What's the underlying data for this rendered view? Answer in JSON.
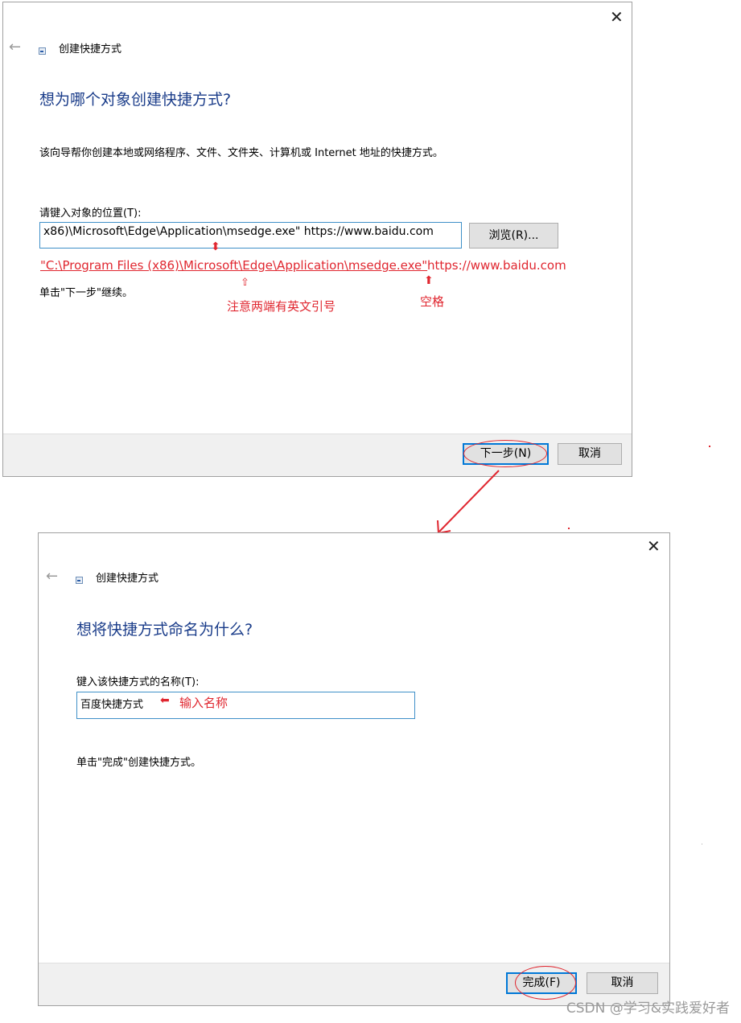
{
  "dialog1": {
    "close_glyph": "✕",
    "back_glyph": "←",
    "window_title": "创建快捷方式",
    "heading": "想为哪个对象创建快捷方式?",
    "description": "该向导帮你创建本地或网络程序、文件、文件夹、计算机或 Internet 地址的快捷方式。",
    "location_label": "请键入对象的位置(T):",
    "location_value": "x86)\\Microsoft\\Edge\\Application\\msedge.exe\" https://www.baidu.com",
    "browse_button": "浏览(R)...",
    "continue_text": "单击\"下一步\"继续。",
    "next_button": "下一步(N)",
    "cancel_button": "取消"
  },
  "annotations": {
    "full_path": "\"C:\\Program Files (x86)\\Microsoft\\Edge\\Application\\msedge.exe\"",
    "url_part": " https://www.baidu.com",
    "quotes_note": "注意两端有英文引号",
    "space_note": "空格",
    "name_note": "输入名称",
    "accent_color": "#e0262f"
  },
  "dialog2": {
    "close_glyph": "✕",
    "back_glyph": "←",
    "window_title": "创建快捷方式",
    "heading": "想将快捷方式命名为什么?",
    "name_label": "键入该快捷方式的名称(T):",
    "name_value": "百度快捷方式",
    "finish_text": "单击\"完成\"创建快捷方式。",
    "finish_button": "完成(F)",
    "cancel_button": "取消"
  },
  "watermark": "CSDN @学习&实践爱好者"
}
